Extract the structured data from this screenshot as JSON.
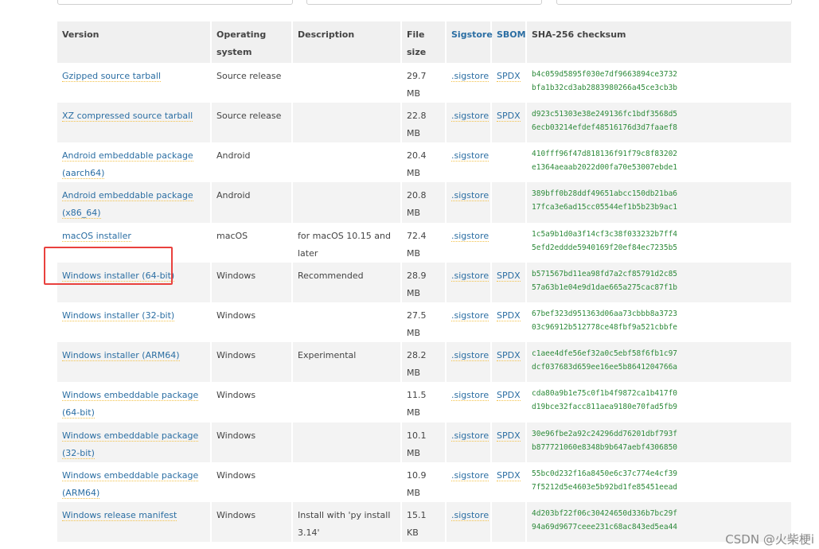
{
  "columns": {
    "version": "Version",
    "os": "Operating system",
    "description": "Description",
    "size": "File size",
    "sigstore": "Sigstore",
    "sbom": "SBOM",
    "checksum": "SHA-256 checksum"
  },
  "rows": [
    {
      "version": "Gzipped source tarball",
      "os": "Source release",
      "description": "",
      "size": "29.7 MB",
      "sigstore": ".sigstore",
      "sbom": "SPDX",
      "checksum_1": "b4c059d5895f030e7df9663894ce3732",
      "checksum_2": "bfa1b32cd3ab2883980266a45ce3cb3b"
    },
    {
      "version": "XZ compressed source tarball",
      "os": "Source release",
      "description": "",
      "size": "22.8 MB",
      "sigstore": ".sigstore",
      "sbom": "SPDX",
      "checksum_1": "d923c51303e38e249136fc1bdf3568d5",
      "checksum_2": "6ecb03214efdef48516176d3d7faaef8"
    },
    {
      "version": "Android embeddable package (aarch64)",
      "os": "Android",
      "description": "",
      "size": "20.4 MB",
      "sigstore": ".sigstore",
      "sbom": "",
      "checksum_1": "410fff96f47d818136f91f79c8f83202",
      "checksum_2": "e1364aeaab2022d00fa70e53007ebde1"
    },
    {
      "version": "Android embeddable package (x86_64)",
      "os": "Android",
      "description": "",
      "size": "20.8 MB",
      "sigstore": ".sigstore",
      "sbom": "",
      "checksum_1": "389bff0b28ddf49651abcc150db21ba6",
      "checksum_2": "17fca3e6ad15cc05544ef1b5b23b9ac1"
    },
    {
      "version": "macOS installer",
      "os": "macOS",
      "description": "for macOS 10.15 and later",
      "size": "72.4 MB",
      "sigstore": ".sigstore",
      "sbom": "",
      "checksum_1": "1c5a9b1d0a3f14cf3c38f033232b7ff4",
      "checksum_2": "5efd2eddde5940169f20ef84ec7235b5"
    },
    {
      "version": "Windows installer (64-bit)",
      "os": "Windows",
      "description": "Recommended",
      "size": "28.9 MB",
      "sigstore": ".sigstore",
      "sbom": "SPDX",
      "checksum_1": "b571567bd11ea98fd7a2cf85791d2c85",
      "checksum_2": "57a63b1e04e9d1dae665a275cac87f1b"
    },
    {
      "version": "Windows installer (32-bit)",
      "os": "Windows",
      "description": "",
      "size": "27.5 MB",
      "sigstore": ".sigstore",
      "sbom": "SPDX",
      "checksum_1": "67bef323d951363d06aa73cbbb8a3723",
      "checksum_2": "03c96912b512778ce48fbf9a521cbbfe"
    },
    {
      "version": "Windows installer (ARM64)",
      "os": "Windows",
      "description": "Experimental",
      "size": "28.2 MB",
      "sigstore": ".sigstore",
      "sbom": "SPDX",
      "checksum_1": "c1aee4dfe56ef32a0c5ebf58f6fb1c97",
      "checksum_2": "dcf037683d659ee16ee5b8641204766a"
    },
    {
      "version": "Windows embeddable package (64-bit)",
      "os": "Windows",
      "description": "",
      "size": "11.5 MB",
      "sigstore": ".sigstore",
      "sbom": "SPDX",
      "checksum_1": "cda80a9b1e75c0f1b4f9872ca1b417f0",
      "checksum_2": "d19bce32facc811aea9180e70fad5fb9"
    },
    {
      "version": "Windows embeddable package (32-bit)",
      "os": "Windows",
      "description": "",
      "size": "10.1 MB",
      "sigstore": ".sigstore",
      "sbom": "SPDX",
      "checksum_1": "30e96fbe2a92c24296dd76201dbf793f",
      "checksum_2": "b877721060e8348b9b647aebf4306850"
    },
    {
      "version": "Windows embeddable package (ARM64)",
      "os": "Windows",
      "description": "",
      "size": "10.9 MB",
      "sigstore": ".sigstore",
      "sbom": "SPDX",
      "checksum_1": "55bc0d232f16a8450e6c37c774e4cf39",
      "checksum_2": "7f5212d5e4603e5b92bd1fe85451eead"
    },
    {
      "version": "Windows release manifest",
      "os": "Windows",
      "description": "Install with 'py install 3.14'",
      "size": "15.1 KB",
      "sigstore": ".sigstore",
      "sbom": "",
      "checksum_1": "4d203bf22f06c30424650d336b7bc29f",
      "checksum_2": "94a69d9677ceee231c68ac843ed5ea44"
    }
  ],
  "watermark": "CSDN @火柴梗i",
  "colors": {
    "link": "#2b6ea3",
    "checksum": "#2d8a3a",
    "highlight": "#e9413e",
    "stripe": "#f3f3f3"
  }
}
